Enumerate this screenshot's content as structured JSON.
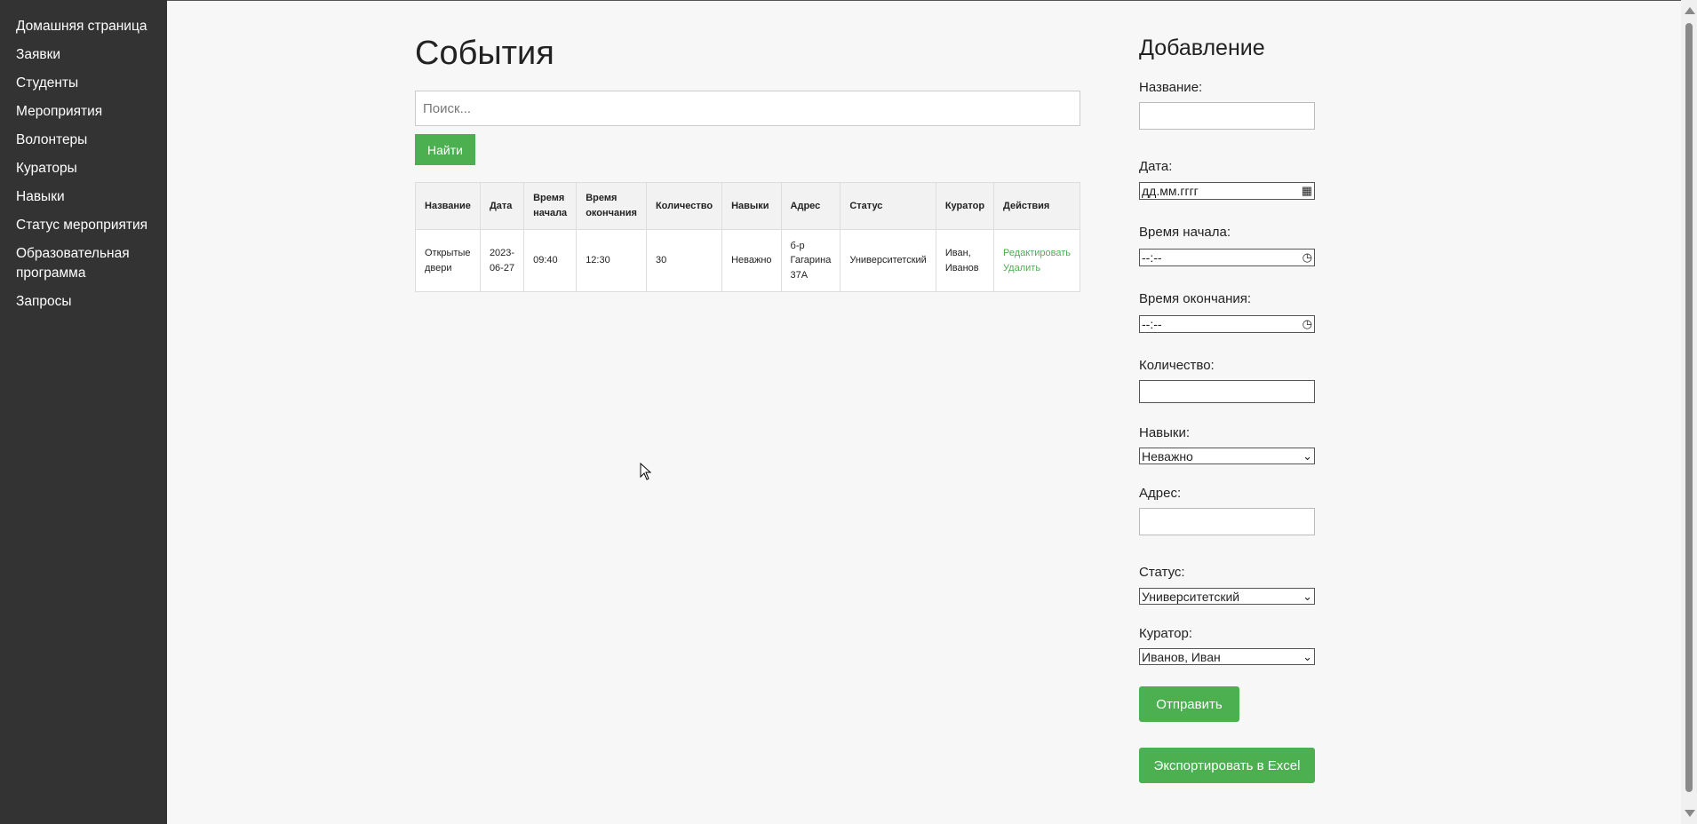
{
  "sidebar": {
    "items": [
      {
        "label": "Домашняя страница"
      },
      {
        "label": "Заявки"
      },
      {
        "label": "Студенты"
      },
      {
        "label": "Мероприятия"
      },
      {
        "label": "Волонтеры"
      },
      {
        "label": "Кураторы"
      },
      {
        "label": "Навыки"
      },
      {
        "label": "Статус мероприятия"
      },
      {
        "label": "Образовательная программа"
      },
      {
        "label": "Запросы"
      }
    ]
  },
  "main": {
    "title": "События",
    "search_placeholder": "Поиск...",
    "search_button": "Найти",
    "table": {
      "columns": [
        "Название",
        "Дата",
        "Время начала",
        "Время окончания",
        "Количество",
        "Навыки",
        "Адрес",
        "Статус",
        "Куратор",
        "Действия"
      ],
      "rows": [
        {
          "name": "Открытые двери",
          "date": "2023-06-27",
          "start": "09:40",
          "end": "12:30",
          "count": "30",
          "skills": "Неважно",
          "address": "б-р Гагарина 37А",
          "status": "Университетский",
          "curator": "Иван, Иванов",
          "edit": "Редактировать",
          "delete": "Удалить"
        }
      ]
    }
  },
  "form": {
    "title": "Добавление",
    "name_label": "Название:",
    "name_value": "",
    "date_label": "Дата:",
    "date_value": "дд.мм.гггг",
    "start_label": "Время начала:",
    "start_value": "--:--",
    "end_label": "Время окончания:",
    "end_value": "--:--",
    "count_label": "Количество:",
    "count_value": "",
    "skills_label": "Навыки:",
    "skills_value": "Неважно",
    "address_label": "Адрес:",
    "address_value": "",
    "status_label": "Статус:",
    "status_value": "Университетский",
    "curator_label": "Куратор:",
    "curator_value": "Иванов, Иван",
    "submit": "Отправить",
    "export": "Экспортировать в Excel"
  },
  "colors": {
    "sidebar_bg": "#333333",
    "accent_green": "#4caf50",
    "page_bg": "#f7f7f7"
  }
}
